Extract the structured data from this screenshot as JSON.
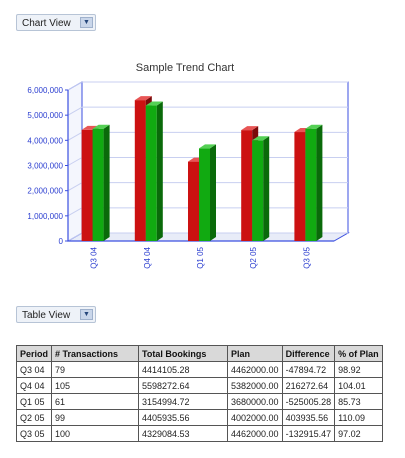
{
  "chart_view_label": "Chart View",
  "table_view_label": "Table View",
  "chart_data": {
    "type": "bar",
    "title": "Sample Trend Chart",
    "categories": [
      "Q3 04",
      "Q4 04",
      "Q1 05",
      "Q2 05",
      "Q3 05"
    ],
    "series": [
      {
        "name": "Total Bookings",
        "values": [
          4414105.28,
          5598272.64,
          3154994.72,
          4405935.56,
          4329084.53
        ]
      },
      {
        "name": "Plan",
        "values": [
          4462000,
          5382000,
          3680000,
          4002000,
          4462000
        ]
      }
    ],
    "ylim": [
      0,
      6000000
    ],
    "yticks": [
      "0",
      "1,000,000",
      "2,000,000",
      "3,000,000",
      "4,000,000",
      "5,000,000",
      "6,000,000"
    ],
    "colors": {
      "series1": "#cc1111",
      "series2": "#11aa11",
      "axis": "#3b4fe0"
    },
    "grid": true
  },
  "table": {
    "headers": [
      "Period",
      "# Transactions",
      "Total Bookings",
      "Plan",
      "Difference",
      "% of Plan"
    ],
    "rows": [
      [
        "Q3 04",
        "79",
        "4414105.28",
        "4462000.00",
        "-47894.72",
        "98.92"
      ],
      [
        "Q4 04",
        "105",
        "5598272.64",
        "5382000.00",
        "216272.64",
        "104.01"
      ],
      [
        "Q1 05",
        "61",
        "3154994.72",
        "3680000.00",
        "-525005.28",
        "85.73"
      ],
      [
        "Q2 05",
        "99",
        "4405935.56",
        "4002000.00",
        "403935.56",
        "110.09"
      ],
      [
        "Q3 05",
        "100",
        "4329084.53",
        "4462000.00",
        "-132915.47",
        "97.02"
      ]
    ]
  }
}
